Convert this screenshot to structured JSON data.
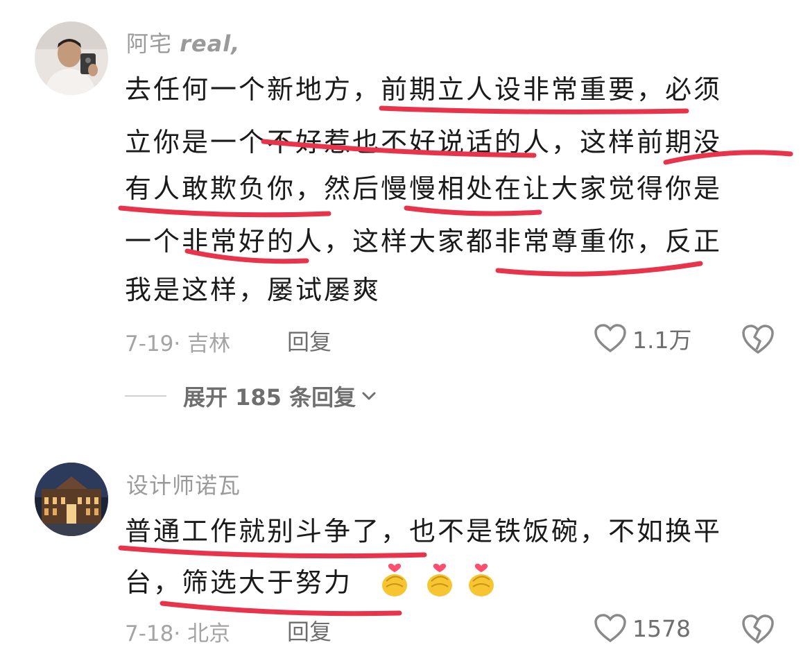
{
  "comments": [
    {
      "username_prefix": "阿宅",
      "username_suffix": "real,",
      "lines": [
        "去任何一个新地方，前期立人设非常重要，必须",
        "立你是一个不好惹也不好说话的人，这样前期没",
        "有人敢欺负你，然后慢慢相处在让大家觉得你是",
        "一个非常好的人，这样大家都非常尊重你，反正",
        "我是这样，屡试屡爽"
      ],
      "meta": "7-19· 吉林",
      "reply_label": "回复",
      "likes": "1.1万",
      "expand_label": "展开 185 条回复"
    },
    {
      "username": "设计师诺瓦",
      "lines": [
        "普通工作就别斗争了，也不是铁饭碗，不如换平",
        "台，筛选大于努力"
      ],
      "meta": "7-18· 北京",
      "reply_label": "回复",
      "likes": "1578"
    }
  ],
  "colors": {
    "underline": "#e8334a",
    "meta_text": "#a4a4a4",
    "body_text": "#1a1a1a"
  },
  "icons": [
    "heart-icon",
    "broken-heart-icon",
    "chevron-down-icon",
    "finger-heart-emoji"
  ]
}
